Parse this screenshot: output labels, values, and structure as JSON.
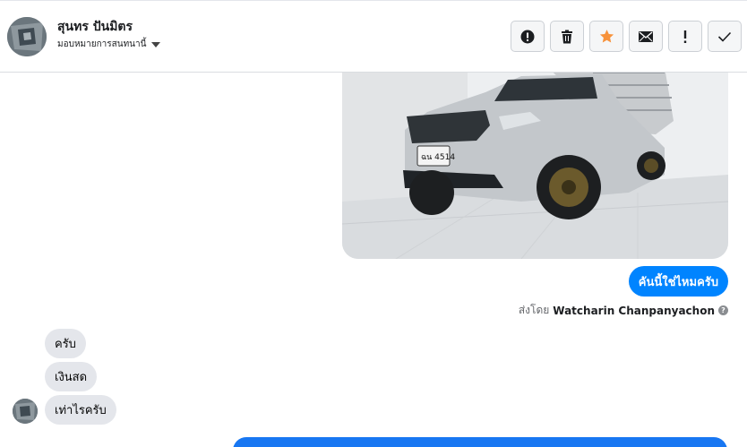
{
  "header": {
    "contact_name": "สุนทร ปันมิตร",
    "assign_label": "มอบหมายการสนทนานี้",
    "actions": [
      {
        "name": "spam-button",
        "glyph": "!"
      },
      {
        "name": "delete-button",
        "glyph": "trash"
      },
      {
        "name": "star-button",
        "glyph": "star"
      },
      {
        "name": "mark-unread-button",
        "glyph": "mail"
      },
      {
        "name": "follow-up-button",
        "glyph": "!"
      },
      {
        "name": "mark-done-button",
        "glyph": "check"
      }
    ]
  },
  "photo": {
    "plate_text": "ฉน 4514"
  },
  "outgoing": {
    "message": "คันนี้ใช่ไหมครับ",
    "sent_by_prefix": "ส่งโดย",
    "sent_by_name": "Watcharin Chanpanyachon"
  },
  "incoming": {
    "messages": [
      "ครับ",
      "เงินสด",
      "เท่าไรครับ"
    ]
  },
  "colors": {
    "accent": "#0084ff",
    "star": "#f7923b",
    "incoming_bubble": "#e4e6eb"
  }
}
